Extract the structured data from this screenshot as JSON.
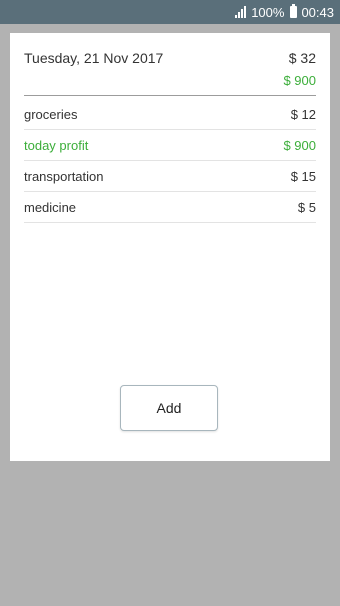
{
  "status_bar": {
    "battery": "100%",
    "time": "00:43",
    "signal_icon": "signal-icon",
    "battery_icon": "battery-icon"
  },
  "day": {
    "date": "Tuesday, 21 Nov 2017",
    "total": "$ 32",
    "profit_total": "$ 900"
  },
  "entries": [
    {
      "label": "groceries",
      "amount": "$ 12",
      "type": "expense"
    },
    {
      "label": "today profit",
      "amount": "$ 900",
      "type": "profit"
    },
    {
      "label": "transportation",
      "amount": "$ 15",
      "type": "expense"
    },
    {
      "label": "medicine",
      "amount": "$ 5",
      "type": "expense"
    }
  ],
  "actions": {
    "add_label": "Add"
  },
  "colors": {
    "status_bar": "#5a6f7a",
    "background": "#b2b2b2",
    "profit": "#3cae3a"
  }
}
